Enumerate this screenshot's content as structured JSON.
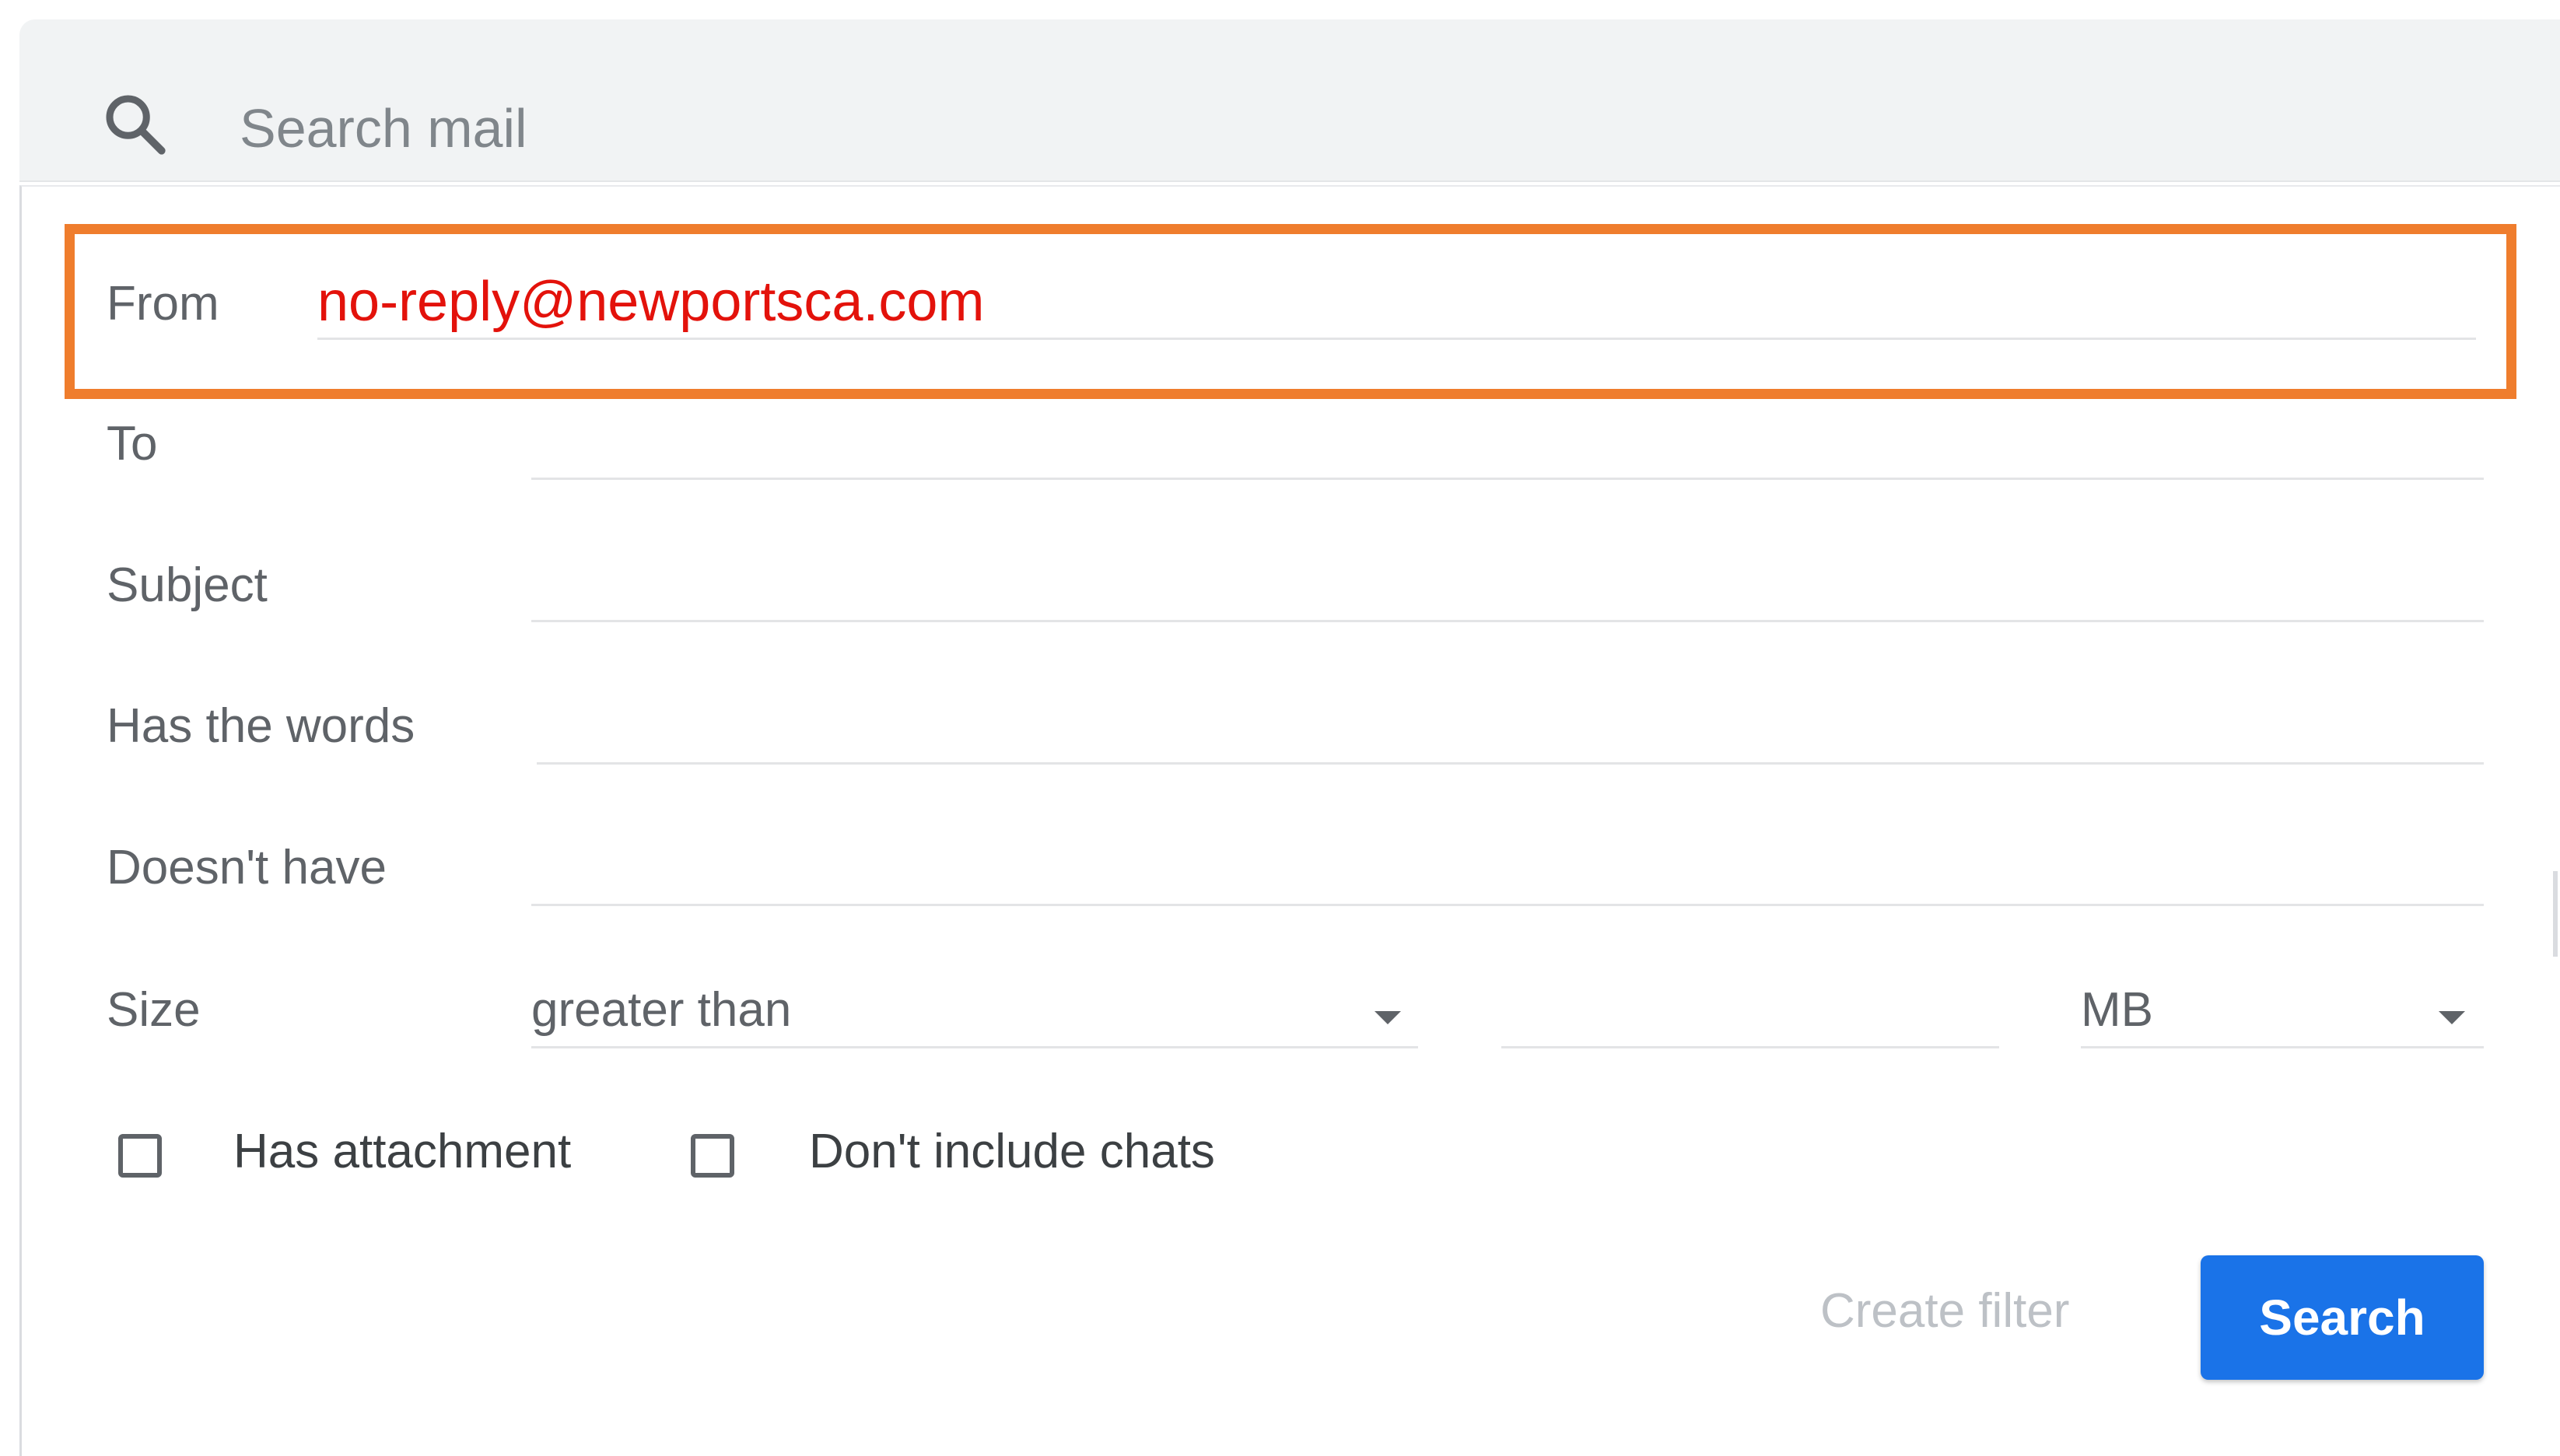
{
  "search": {
    "placeholder": "Search mail",
    "icon": "search-icon"
  },
  "form": {
    "from": {
      "label": "From",
      "value": "no-reply@newportsca.com",
      "value_color": "#e3120b"
    },
    "to": {
      "label": "To",
      "value": ""
    },
    "subject": {
      "label": "Subject",
      "value": ""
    },
    "has_words": {
      "label": "Has the words",
      "value": ""
    },
    "doesnt_have": {
      "label": "Doesn't have",
      "value": ""
    },
    "size": {
      "label": "Size",
      "comparator": "greater than",
      "amount": "",
      "unit": "MB"
    },
    "has_attachment": {
      "label": "Has attachment",
      "checked": false
    },
    "dont_include_chats": {
      "label": "Don't include chats",
      "checked": false
    }
  },
  "actions": {
    "create_filter": "Create filter",
    "search": "Search"
  },
  "colors": {
    "highlight": "#ef7d2d",
    "primary": "#1a73e8",
    "label": "#5f6368",
    "disabled": "#bdc1c6"
  }
}
